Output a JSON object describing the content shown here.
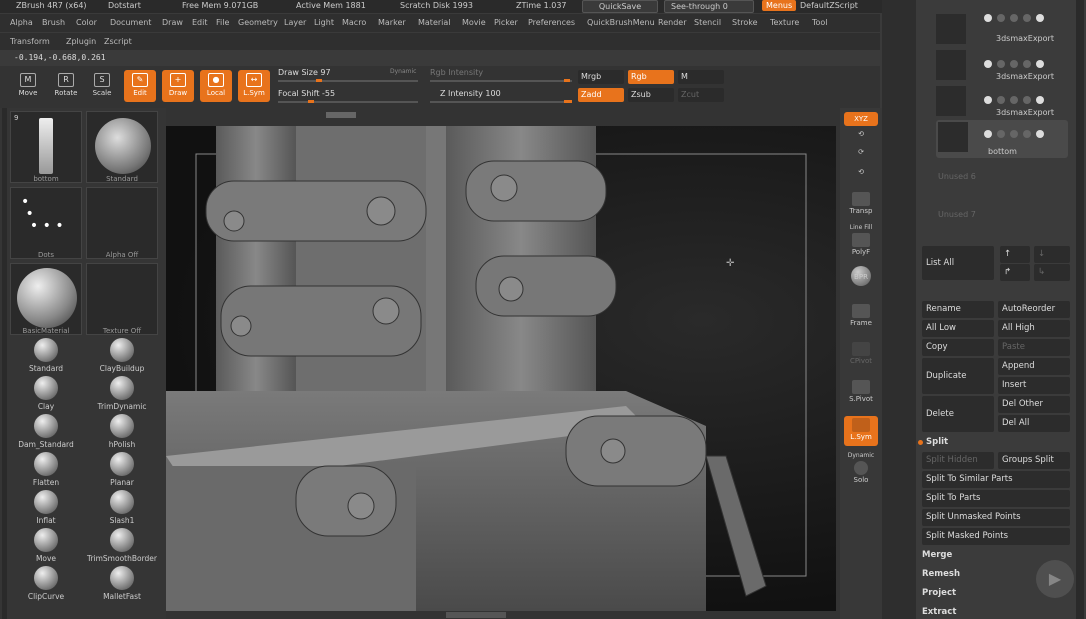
{
  "title_bar": {
    "app": "ZBrush 4R7 (x64)",
    "dots": "Dotstart",
    "free_mem": "Free Mem 9.071GB",
    "active_mem": "Active Mem 1881",
    "scratch": "Scratch Disk 1993",
    "ztime": "ZTime 1.037",
    "quicksave": "QuickSave",
    "see_through": "See-through 0",
    "menus": "Menus",
    "default_script": "DefaultZScript"
  },
  "menu_bar": [
    "Alpha",
    "Brush",
    "Color",
    "Document",
    "Draw",
    "Edit",
    "File",
    "Geometry",
    "Layer",
    "Light",
    "Macro",
    "Marker",
    "Material",
    "Movie",
    "Picker",
    "Preferences",
    "QuickBrushMenu",
    "Render",
    "Stencil",
    "Stroke",
    "Texture",
    "Tool"
  ],
  "menu_bar2": [
    "Transform",
    "Zplugin",
    "Zscript"
  ],
  "coords": "-0.194,-0.668,0.261",
  "toolbar": {
    "move": "Move",
    "rotate": "Rotate",
    "scale": "Scale",
    "edit": "Edit",
    "draw": "Draw",
    "local": "Local",
    "lsym": "L.Sym",
    "draw_size": "Draw Size 97",
    "dynamic": "Dynamic",
    "focal_shift": "Focal Shift -55",
    "rgb_intensity": "Rgb Intensity",
    "z_intensity": "Z Intensity 100",
    "mrgb": "Mrgb",
    "rgb": "Rgb",
    "m": "M",
    "zadd": "Zadd",
    "zsub": "Zsub",
    "zcut": "Zcut"
  },
  "left_panel": {
    "thumbs": [
      {
        "label": "bottom",
        "count": "9"
      },
      {
        "label": "Standard"
      },
      {
        "label": "Dots"
      },
      {
        "label": "Alpha Off"
      },
      {
        "label": "BasicMaterial"
      },
      {
        "label": "Texture Off"
      }
    ],
    "brushes": [
      "Standard",
      "ClayBuildup",
      "Clay",
      "TrimDynamic",
      "Dam_Standard",
      "hPolish",
      "Flatten",
      "Planar",
      "Inflat",
      "Slash1",
      "Move",
      "TrimSmoothBorder",
      "ClipCurve",
      "MalletFast"
    ]
  },
  "right_tools": {
    "xyz": "XYZ",
    "transp": "Transp",
    "line_fill": "Line Fill",
    "polyf": "PolyF",
    "bpr": "BPR",
    "frame": "Frame",
    "cpivot": "CPivot",
    "spivot": "S.Pivot",
    "lsym": "L.Sym",
    "dynamic": "Dynamic",
    "solo": "Solo"
  },
  "right_panel": {
    "subtools": [
      {
        "name": "3dsmaxExport"
      },
      {
        "name": "3dsmaxExport"
      },
      {
        "name": "3dsmaxExport"
      },
      {
        "name": "bottom"
      }
    ],
    "unused": [
      "Unused 6",
      "Unused 7"
    ],
    "list_all": "List All",
    "rename": "Rename",
    "auto_reorder": "AutoReorder",
    "all_low": "All Low",
    "all_high": "All High",
    "copy": "Copy",
    "paste": "Paste",
    "duplicate": "Duplicate",
    "append": "Append",
    "insert": "Insert",
    "delete": "Delete",
    "del_other": "Del Other",
    "del_all": "Del All",
    "split": "Split",
    "split_hidden": "Split Hidden",
    "groups_split": "Groups Split",
    "split_similar": "Split To Similar Parts",
    "split_parts": "Split To Parts",
    "split_unmasked": "Split Unmasked Points",
    "split_masked": "Split Masked Points",
    "merge": "Merge",
    "remesh": "Remesh",
    "project": "Project",
    "extract": "Extract"
  },
  "colors": {
    "accent": "#e8731c",
    "panel": "#3b3b3b",
    "bg": "#333333"
  }
}
